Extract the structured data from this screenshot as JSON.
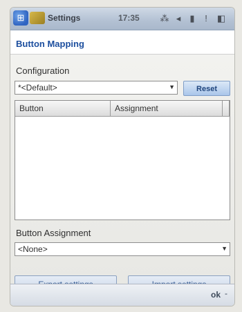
{
  "status_bar": {
    "app_title": "Settings",
    "time": "17:35",
    "icons": [
      "signal-icon",
      "speaker-icon",
      "battery-icon",
      "notification-icon"
    ]
  },
  "header": {
    "title": "Button Mapping"
  },
  "configuration": {
    "label": "Configuration",
    "selected_value": "*<Default>",
    "reset_label": "Reset"
  },
  "list": {
    "columns": [
      "Button",
      "Assignment"
    ]
  },
  "assignment": {
    "label": "Button Assignment",
    "selected_value": "<None>"
  },
  "actions": {
    "export_label": "Export settings",
    "import_label": "Import settings"
  },
  "softkeys": {
    "ok_label": "ok",
    "menu_label": "-"
  },
  "colors": {
    "title_blue": "#1c4e9e",
    "button_text_blue": "#3a5f96"
  }
}
